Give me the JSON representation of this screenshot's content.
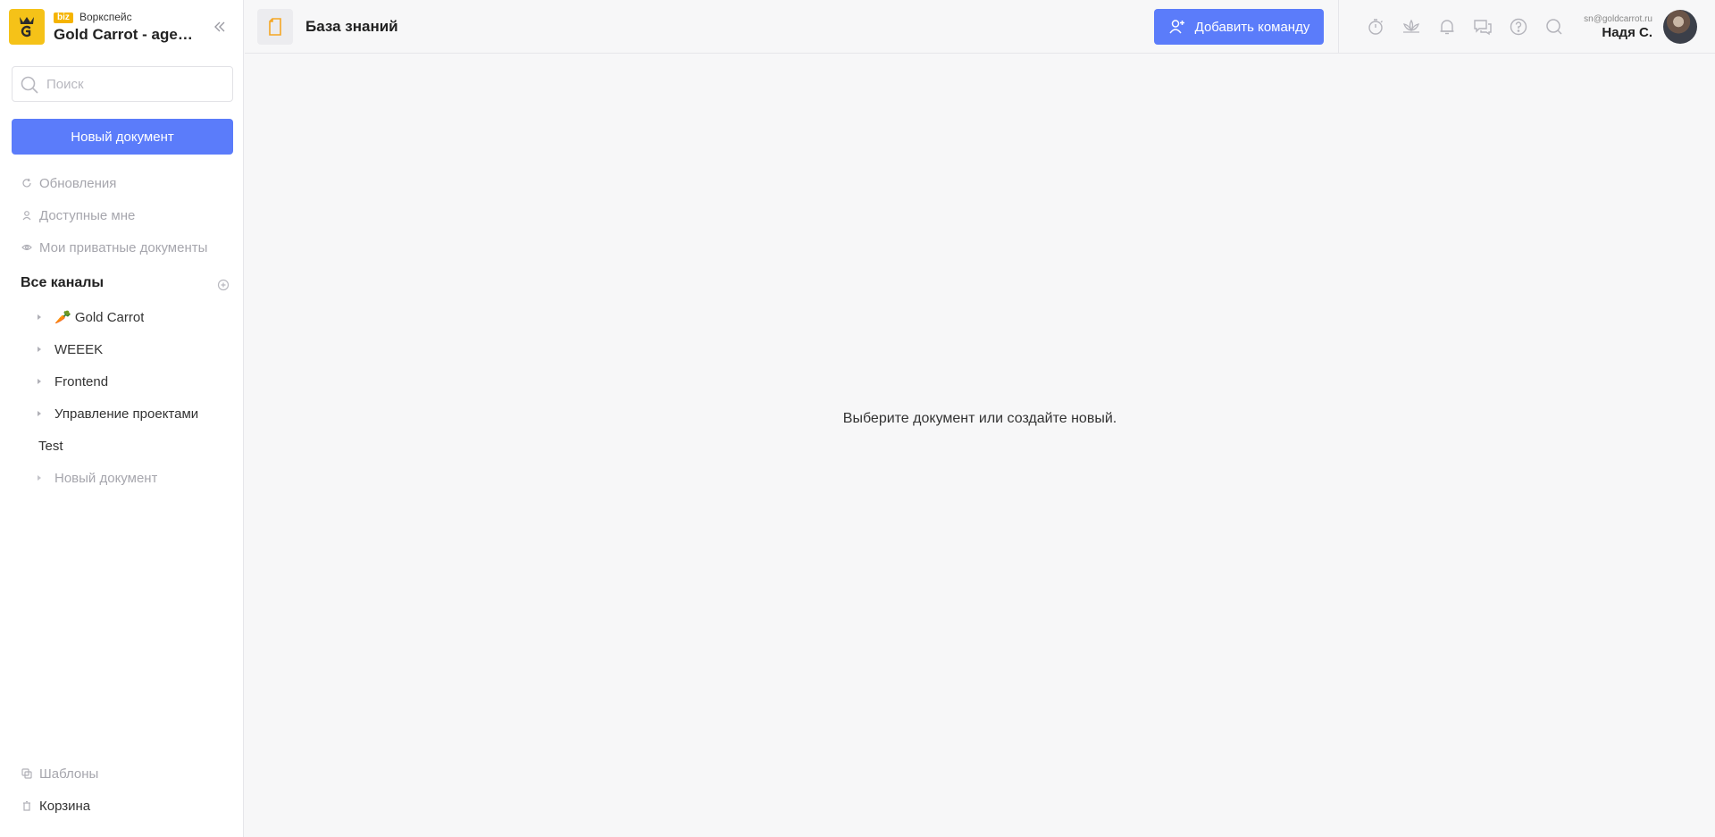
{
  "workspace": {
    "badge": "biz",
    "label": "Воркспейс",
    "name": "Gold Carrot - agency"
  },
  "sidebar": {
    "search_placeholder": "Поиск",
    "new_document": "Новый документ",
    "nav": [
      {
        "label": "Обновления",
        "icon": "refresh-icon"
      },
      {
        "label": "Доступные мне",
        "icon": "user-icon"
      },
      {
        "label": "Мои приватные документы",
        "icon": "eye-icon"
      }
    ],
    "channels_title": "Все каналы",
    "channels": [
      {
        "label": "🥕 Gold Carrot"
      },
      {
        "label": "WEEEK"
      },
      {
        "label": "Frontend"
      },
      {
        "label": "Управление проектами"
      }
    ],
    "root_item": "Test",
    "sub_item": "Новый документ",
    "bottom": [
      {
        "label": "Шаблоны",
        "icon": "templates-icon"
      },
      {
        "label": "Корзина",
        "icon": "trash-icon"
      }
    ]
  },
  "topbar": {
    "title": "База знаний",
    "add_team": "Добавить команду",
    "icons": [
      "timer-icon",
      "meditation-icon",
      "bell-icon",
      "chat-icon",
      "help-icon",
      "search-icon"
    ]
  },
  "user": {
    "email": "sn@goldcarrot.ru",
    "name": "Надя С."
  },
  "main": {
    "empty_message": "Выберите документ или создайте новый."
  },
  "colors": {
    "accent": "#5b7cfa",
    "logo": "#f5c218",
    "badge": "#f5b400"
  }
}
